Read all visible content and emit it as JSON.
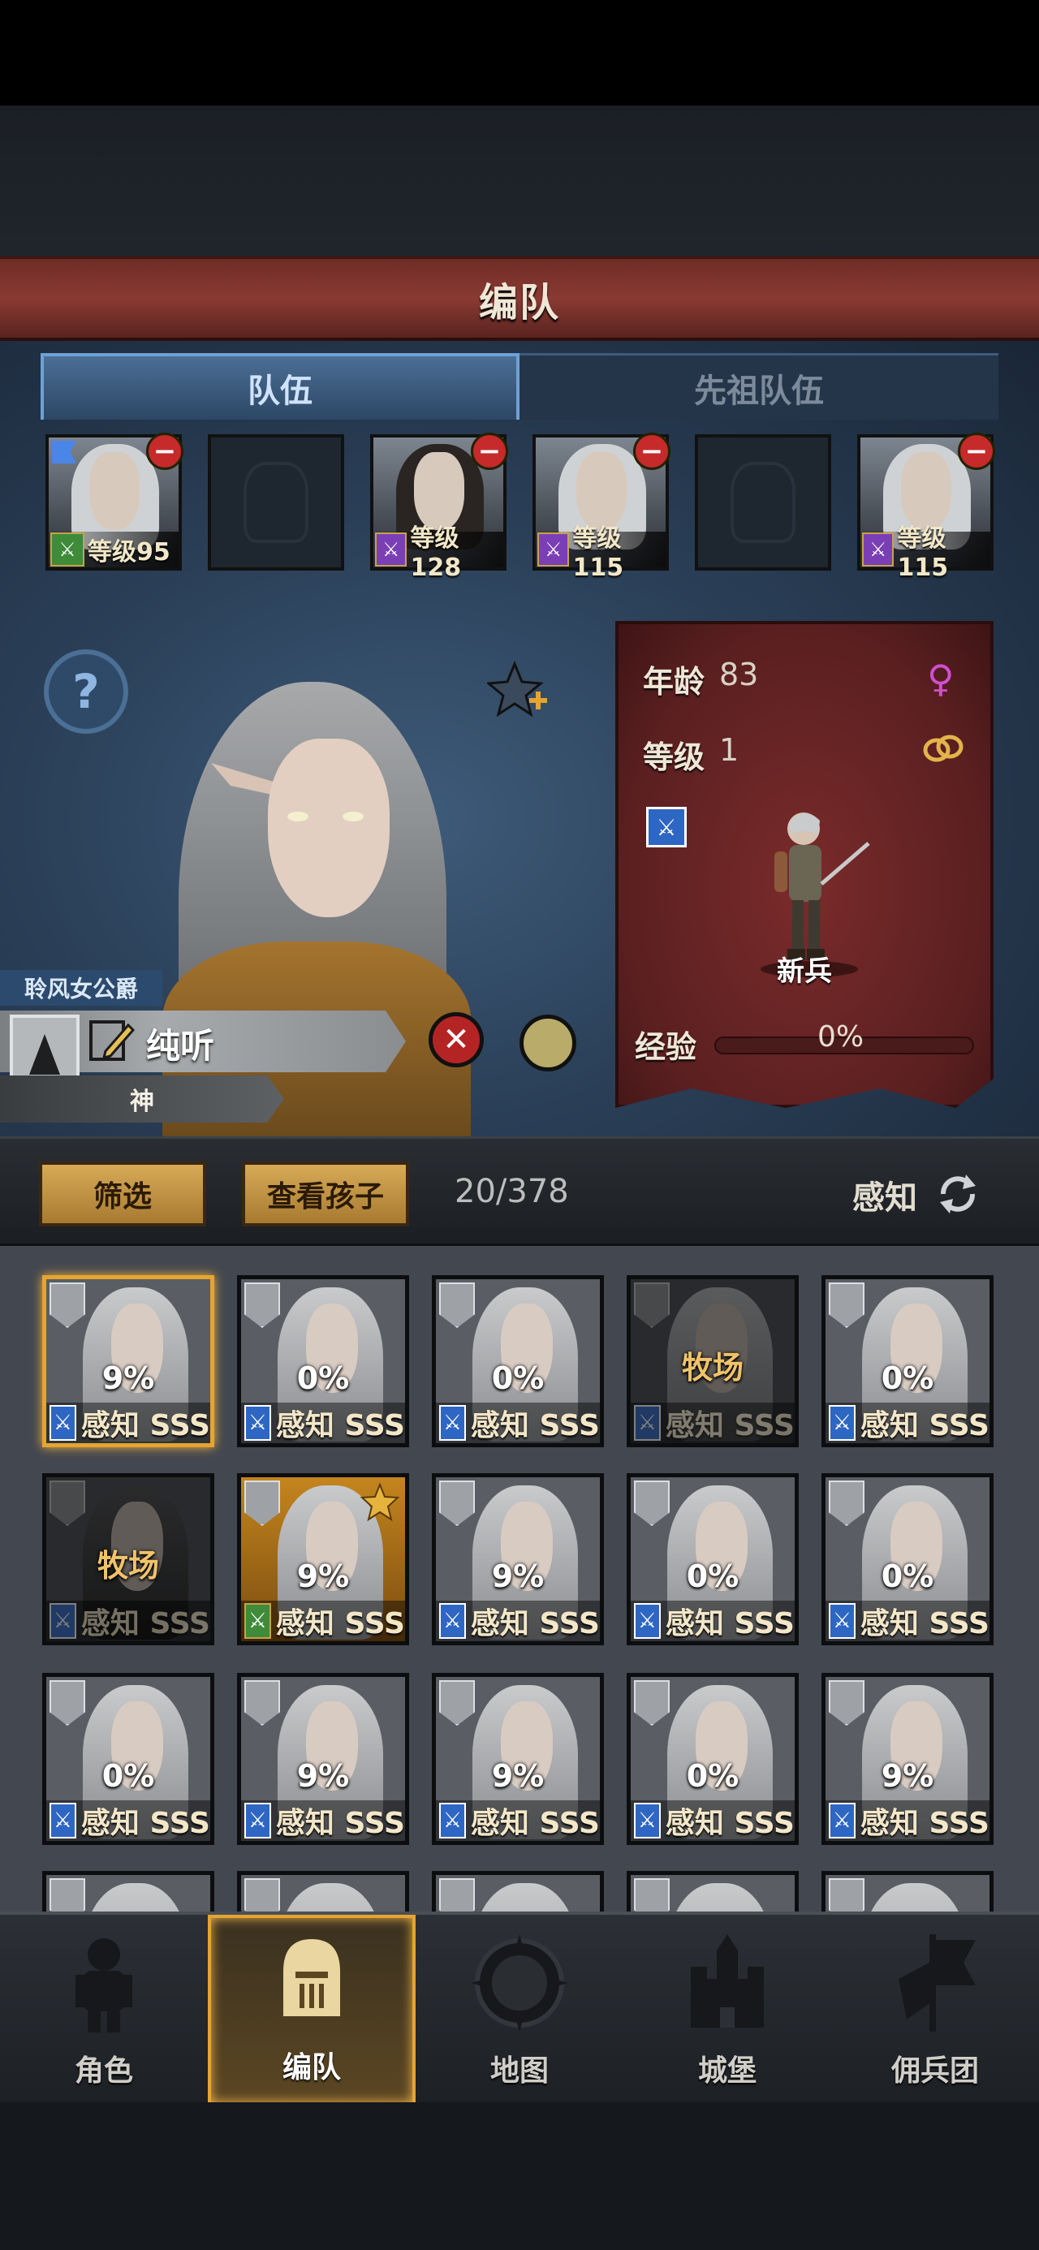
{
  "header": {
    "title": "编队"
  },
  "tabs": [
    {
      "label": "队伍",
      "active": true
    },
    {
      "label": "先祖队伍",
      "active": false
    }
  ],
  "team": [
    {
      "filled": true,
      "level": "等级95",
      "class": "green",
      "hair": "light",
      "flag": true
    },
    {
      "filled": false
    },
    {
      "filled": true,
      "level": "等级128",
      "class": "purple",
      "hair": "dark"
    },
    {
      "filled": true,
      "level": "等级115",
      "class": "purple",
      "hair": "light"
    },
    {
      "filled": false
    },
    {
      "filled": true,
      "level": "等级115",
      "class": "purple",
      "hair": "light"
    }
  ],
  "hero": {
    "title_tag": "聆风女公爵",
    "name": "纯听",
    "rank": "神"
  },
  "stats": {
    "age_label": "年龄",
    "age_value": "83",
    "level_label": "等级",
    "level_value": "1",
    "class_name": "新兵",
    "exp_label": "经验",
    "exp_value": "0%",
    "exp_progress": 0
  },
  "filter": {
    "filter_label": "筛选",
    "children_label": "查看孩子",
    "count": "20/378",
    "sort_label": "感知"
  },
  "roster": [
    {
      "pct": "9%",
      "attr": "感知 SSS",
      "selected": true
    },
    {
      "pct": "0%",
      "attr": "感知 SSS"
    },
    {
      "pct": "0%",
      "attr": "感知 SSS"
    },
    {
      "ranch": "牧场",
      "attr": "感知 SSS"
    },
    {
      "pct": "0%",
      "attr": "感知 SSS"
    },
    {
      "ranch": "牧场",
      "attr": "感知 SSS",
      "dark": true
    },
    {
      "pct": "9%",
      "attr": "感知 SSS",
      "gold": true,
      "star": true
    },
    {
      "pct": "9%",
      "attr": "感知 SSS"
    },
    {
      "pct": "0%",
      "attr": "感知 SSS"
    },
    {
      "pct": "0%",
      "attr": "感知 SSS"
    },
    {
      "pct": "0%",
      "attr": "感知 SSS"
    },
    {
      "pct": "9%",
      "attr": "感知 SSS"
    },
    {
      "pct": "9%",
      "attr": "感知 SSS"
    },
    {
      "pct": "0%",
      "attr": "感知 SSS"
    },
    {
      "pct": "9%",
      "attr": "感知 SSS"
    }
  ],
  "nav": [
    {
      "label": "角色",
      "icon": "knight-icon",
      "active": false
    },
    {
      "label": "编队",
      "icon": "helmet-icon",
      "active": true
    },
    {
      "label": "地图",
      "icon": "compass-icon",
      "active": false
    },
    {
      "label": "城堡",
      "icon": "castle-icon",
      "active": false
    },
    {
      "label": "佣兵团",
      "icon": "banner-icon",
      "active": false
    }
  ],
  "colors": {
    "title_bar": "#8a3a32",
    "accent_gold": "#e6a430",
    "tab_active": "#6ea1d6",
    "class_blue": "#2e66c4",
    "class_purple": "#7b3fb5",
    "class_green": "#3e8b3a"
  }
}
